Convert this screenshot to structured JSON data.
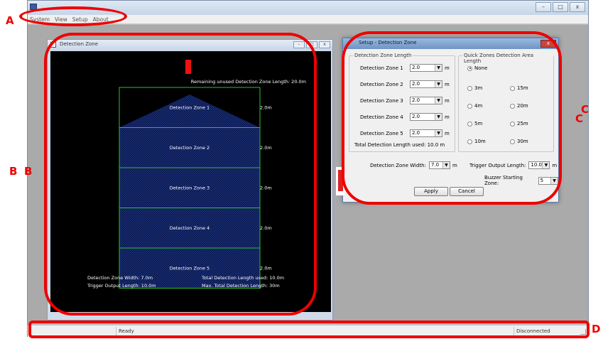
{
  "window": {
    "icon": "app-icon",
    "minimize": "–",
    "maximize": "□",
    "close": "x"
  },
  "menu": [
    "System",
    "View",
    "Setup",
    "About"
  ],
  "dz_window": {
    "title": "Detection Zone",
    "remaining": "Remaining unused Detection Zone Length: 20.0m",
    "zones": [
      {
        "label": "Detection Zone 1",
        "length": "2.0m"
      },
      {
        "label": "Detection Zone 2",
        "length": "2.0m"
      },
      {
        "label": "Detection Zone 3",
        "length": "2.0m"
      },
      {
        "label": "Detection Zone 4",
        "length": "2.0m"
      },
      {
        "label": "Detection Zone 5",
        "length": "2.0m"
      }
    ],
    "summary": {
      "width": "Detection Zone Width: 7.0m",
      "trigger": "Trigger Output Length: 10.0m",
      "total": "Total Detection Length used: 10.0m",
      "max": "Max. Total Detection Length: 30m"
    },
    "colors": {
      "zone_fill": "#0a1a55",
      "zone_border": "#2fbf2f",
      "sensor": "#ee1111"
    }
  },
  "setup_dialog": {
    "title": "Setup - Detection Zone",
    "length_group": "Detection Zone Length",
    "zones": [
      {
        "label": "Detection Zone 1",
        "value": "2.0"
      },
      {
        "label": "Detection Zone 2",
        "value": "2.0"
      },
      {
        "label": "Detection Zone 3",
        "value": "2.0"
      },
      {
        "label": "Detection Zone 4",
        "value": "2.0"
      },
      {
        "label": "Detection Zone 5",
        "value": "2.0"
      }
    ],
    "unit": "m",
    "total_used": "Total Detection Length used: 10.0 m",
    "quick_group": "Quick Zones Detection Area Length",
    "quick_options": [
      "None",
      "3m",
      "15m",
      "4m",
      "20m",
      "5m",
      "25m",
      "10m",
      "30m"
    ],
    "quick_selected": "None",
    "width_label": "Detection Zone Width:",
    "width_value": "7.0",
    "trigger_label": "Trigger Output Length:",
    "trigger_value": "10.0",
    "buzzer_label": "Buzzer Starting Zone:",
    "buzzer_value": "5",
    "apply": "Apply",
    "cancel": "Cancel"
  },
  "status": {
    "left": "Ready",
    "right": "Disconnected"
  },
  "annotations": [
    "A",
    "B",
    "B",
    "C",
    "C",
    "D"
  ]
}
